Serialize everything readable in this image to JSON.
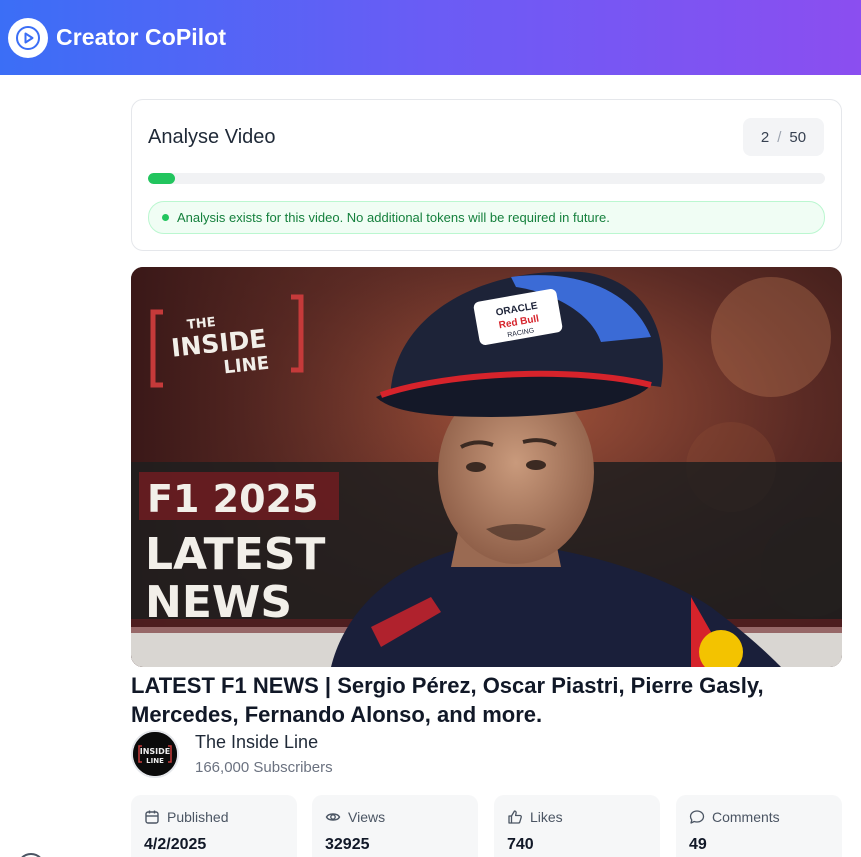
{
  "header": {
    "app_title": "Creator CoPilot",
    "logo_icon": "play-circle-icon"
  },
  "analyse": {
    "title": "Analyse Video",
    "used": "2",
    "separator": "/",
    "limit": "50",
    "progress_fraction": 0.04,
    "notice": "Analysis exists for this video. No additional tokens will be required in future.",
    "accent_color": "#22c55e"
  },
  "thumbnail": {
    "show_name_line1": "THE",
    "show_name_line2": "INSIDE",
    "show_name_line3": "LINE",
    "year_text": "F1 2025",
    "headline_line1": "LATEST",
    "headline_line2": "NEWS",
    "cap_brand_top": "ORACLE",
    "cap_brand_bottom": "Red Bull",
    "cap_brand_sub": "RACING"
  },
  "video": {
    "title": "LATEST F1 NEWS | Sergio Pérez, Oscar Piastri, Pierre Gasly, Mercedes, Fernando Alonso, and more."
  },
  "channel": {
    "name": "The Inside Line",
    "subscribers": "166,000 Subscribers",
    "avatar_text_line1": "INSIDE",
    "avatar_text_line2": "LINE"
  },
  "stats": [
    {
      "label": "Published",
      "value": "4/2/2025",
      "icon": "calendar-icon"
    },
    {
      "label": "Views",
      "value": "32925",
      "icon": "eye-icon"
    },
    {
      "label": "Likes",
      "value": "740",
      "icon": "thumbs-up-icon"
    },
    {
      "label": "Comments",
      "value": "49",
      "icon": "comment-icon"
    }
  ]
}
